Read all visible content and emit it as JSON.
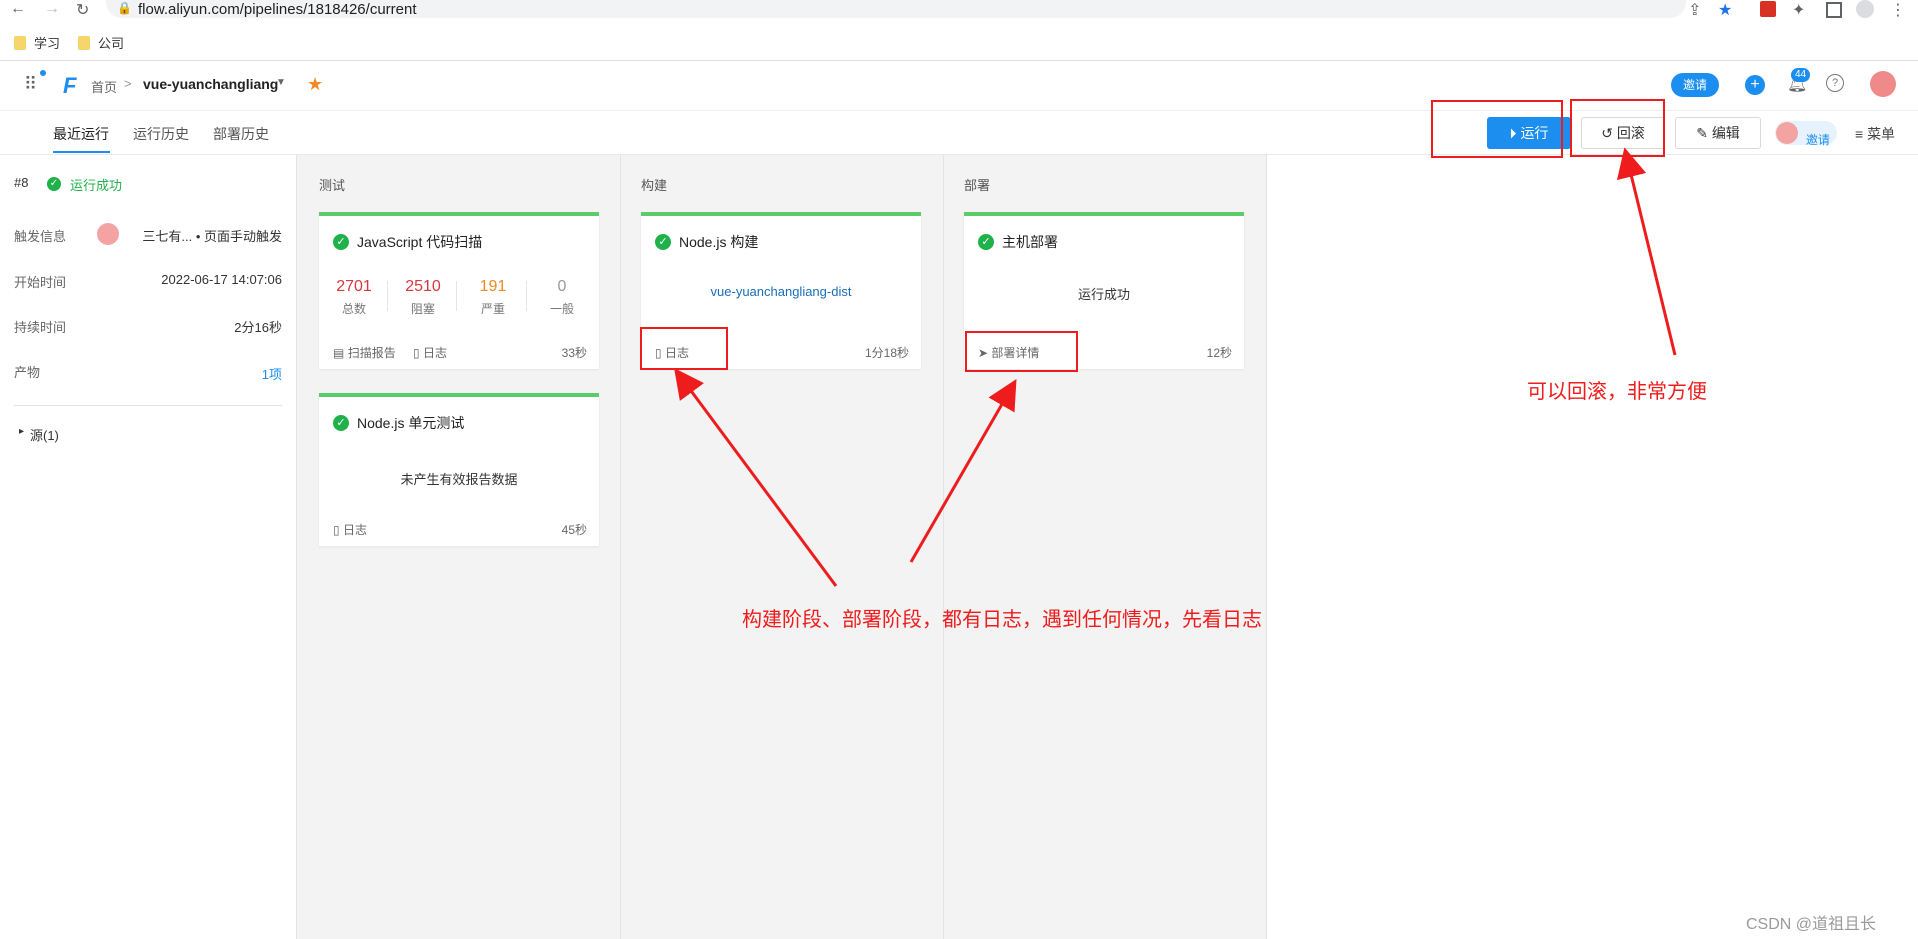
{
  "browser": {
    "url": "flow.aliyun.com/pipelines/1818426/current"
  },
  "bookmarks": [
    {
      "label": "学习"
    },
    {
      "label": "公司"
    }
  ],
  "header": {
    "home": "首页",
    "breadcrumb_sep": ">",
    "project": "vue-yuanchangliang",
    "invite": "邀请",
    "notif_count": "44"
  },
  "tabs": [
    {
      "label": "最近运行"
    },
    {
      "label": "运行历史"
    },
    {
      "label": "部署历史"
    }
  ],
  "toolbar": {
    "run": "运行",
    "rollback": "回滚",
    "edit": "编辑",
    "invite": "邀请",
    "menu": "菜单"
  },
  "run_info": {
    "number": "#8",
    "status": "运行成功",
    "trigger_label": "触发信息",
    "trigger_value": "三七有... • 页面手动触发",
    "start_label": "开始时间",
    "start_value": "2022-06-17 14:07:06",
    "duration_label": "持续时间",
    "duration_value": "2分16秒",
    "artifact_label": "产物",
    "artifact_value": "1项",
    "source": "源(1)"
  },
  "stages": {
    "test": {
      "title": "测试",
      "scan_job": {
        "title": "JavaScript 代码扫描",
        "metrics": [
          {
            "value": "2701",
            "label": "总数",
            "color": "#d9363e"
          },
          {
            "value": "2510",
            "label": "阻塞",
            "color": "#d9363e"
          },
          {
            "value": "191",
            "label": "严重",
            "color": "#f08a24"
          },
          {
            "value": "0",
            "label": "一般",
            "color": "#999999"
          }
        ],
        "report": "扫描报告",
        "log": "日志",
        "time": "33秒"
      },
      "unit_job": {
        "title": "Node.js 单元测试",
        "message": "未产生有效报告数据",
        "log": "日志",
        "time": "45秒"
      }
    },
    "build": {
      "title": "构建",
      "job": {
        "title": "Node.js 构建",
        "artifact": "vue-yuanchangliang-dist",
        "log": "日志",
        "time": "1分18秒"
      }
    },
    "deploy": {
      "title": "部署",
      "job": {
        "title": "主机部署",
        "message": "运行成功",
        "detail": "部署详情",
        "time": "12秒"
      }
    }
  },
  "annotations": {
    "rollback_note": "可以回滚，非常方便",
    "log_note": "构建阶段、部署阶段，都有日志，遇到任何情况，先看日志"
  },
  "watermark": "CSDN @道祖且长",
  "colors": {
    "accent": "#1b8ef0",
    "success": "#1fb24a",
    "annotation": "#ee1c1c"
  }
}
